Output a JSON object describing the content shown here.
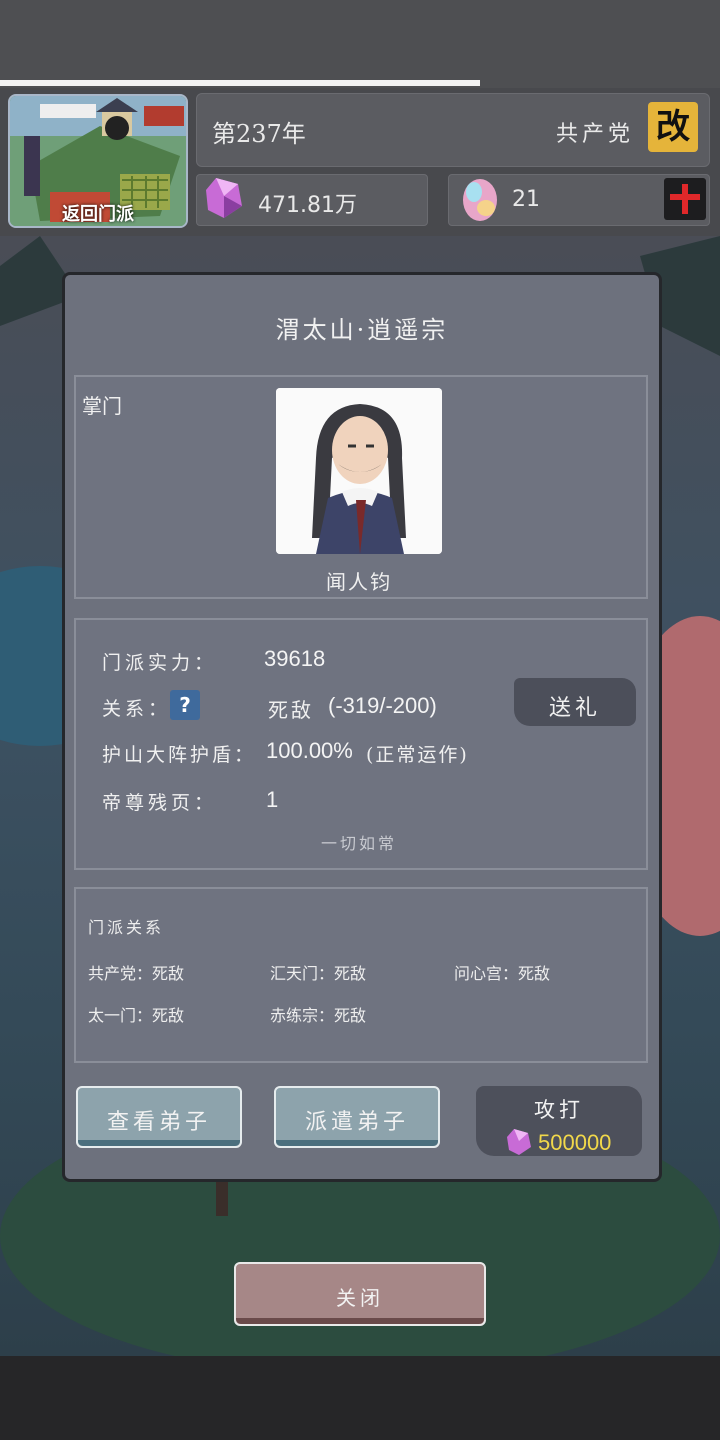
{
  "hud": {
    "map_label": "返回门派",
    "year": "第237年",
    "faction": "共产党",
    "change_label": "改",
    "spirit_stones": "471.81万",
    "gems": "21",
    "progress": 0.667
  },
  "dialog": {
    "title": "渭太山·逍遥宗",
    "leader_label": "掌门",
    "leader_name": "闻人钧",
    "stats": {
      "power_label": "门派实力：",
      "power_value": "39618",
      "relation_label": "关系：",
      "relation_icon": "?",
      "relation_value": "死敌",
      "relation_score": "(-319/-200)",
      "gift_label": "送礼",
      "shield_label": "护山大阵护盾：",
      "shield_value": "100.00%",
      "shield_status": "(正常运作)",
      "pages_label": "帝尊残页：",
      "pages_value": "1",
      "status_note": "一切如常"
    },
    "relations": {
      "heading": "门派关系",
      "items": [
        {
          "name": "共产党",
          "status": "死敌"
        },
        {
          "name": "汇天门",
          "status": "死敌"
        },
        {
          "name": "问心宫",
          "status": "死敌"
        },
        {
          "name": "太一门",
          "status": "死敌"
        },
        {
          "name": "赤练宗",
          "status": "死敌"
        }
      ]
    },
    "buttons": {
      "view_disciples": "查看弟子",
      "send_disciples": "派遣弟子",
      "attack": "攻打",
      "attack_cost": "500000"
    },
    "close_label": "关闭"
  },
  "colors": {
    "accent_gold": "#e5b43a",
    "dialog_bg": "#6d717d",
    "cost_yellow": "#f1d84a"
  }
}
